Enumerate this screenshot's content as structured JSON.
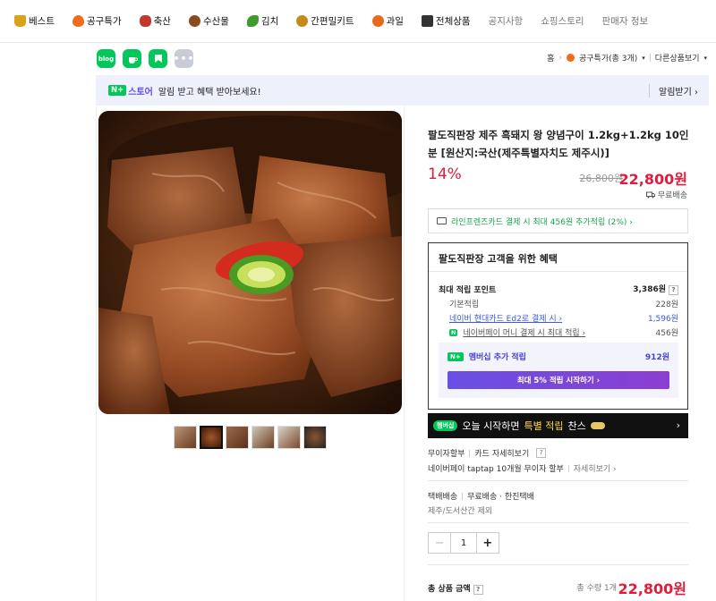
{
  "nav": [
    {
      "label": "베스트",
      "icon": "trophy-icon",
      "color": "#d9a21b"
    },
    {
      "label": "공구특가",
      "icon": "fire-icon",
      "color": "#f26b1d"
    },
    {
      "label": "축산",
      "icon": "meat-icon",
      "color": "#c0392b"
    },
    {
      "label": "수산물",
      "icon": "seafood-icon",
      "color": "#8b4a1e"
    },
    {
      "label": "김치",
      "icon": "pepper-icon",
      "color": "#3f9b2e"
    },
    {
      "label": "간편밀키트",
      "icon": "mealkit-icon",
      "color": "#c58a1a"
    },
    {
      "label": "과일",
      "icon": "fruit-icon",
      "color": "#e86a1a"
    },
    {
      "label": "전체상품",
      "icon": "cart-icon",
      "color": "#333333"
    },
    {
      "label": "공지사항"
    },
    {
      "label": "쇼핑스토리"
    },
    {
      "label": "판매자 정보"
    }
  ],
  "share": {
    "blog": "blog"
  },
  "breadcrumb": {
    "home": "홈",
    "category": "공구특가(총 3개)",
    "more": "다른상품보기"
  },
  "banner": {
    "badge": "N+",
    "store": "스토어",
    "text": "알림 받고 혜택 받아보세요!",
    "alarm": "알림받기 ›"
  },
  "product": {
    "title": "팔도직판장 제주 흑돼지 왕 양념구이 1.2kg+1.2kg 10인분 [원산지:국산(제주특별자치도 제주시)]",
    "discount": "14%",
    "original_price": "26,800원",
    "price": "22,800원",
    "shipping": "무료배송"
  },
  "card": {
    "text": "라인프렌즈카드 결제 시 최대 456원 추가적립 (2%) ›"
  },
  "benefit": {
    "heading": "팔도직판장 고객을 위한 혜택",
    "max_label": "최대 적립 포인트",
    "max_value": "3,386원",
    "rows": [
      {
        "label": "기본적립",
        "value": "228원"
      },
      {
        "label": "네이버 현대카드 Ed2로 결제 시 ›",
        "value": "1,596원"
      },
      {
        "label": "네이버페이 머니 결제 시 최대 적립 ›",
        "value": "456원"
      }
    ],
    "member_label": "멤버십 추가 적립",
    "member_value": "912원",
    "member_button": "최대 5% 적립 시작하기 ›"
  },
  "promo": {
    "badge": "멤버십",
    "pre": "오늘 시작하면",
    "highlight": "특별 적립",
    "post": "찬스",
    "arrow": "›"
  },
  "installment": {
    "label": "무이자할부",
    "card_detail": "카드 자세히보기",
    "npay": "네이버페이 taptap 10개월 무이자 할부",
    "detail": "자세히보기 ›"
  },
  "delivery": {
    "type": "택배배송",
    "fee": "무료배송 · 한진택배",
    "note": "제주/도서산간 제외"
  },
  "quantity": {
    "minus": "−",
    "value": "1",
    "plus": "+"
  },
  "total": {
    "label": "총 상품 금액",
    "count": "총 수량 1개",
    "price": "22,800원"
  },
  "colors": {
    "accent": "#e01d3a",
    "naver_green": "#03c75a",
    "store_purple": "#5c4fe8"
  }
}
